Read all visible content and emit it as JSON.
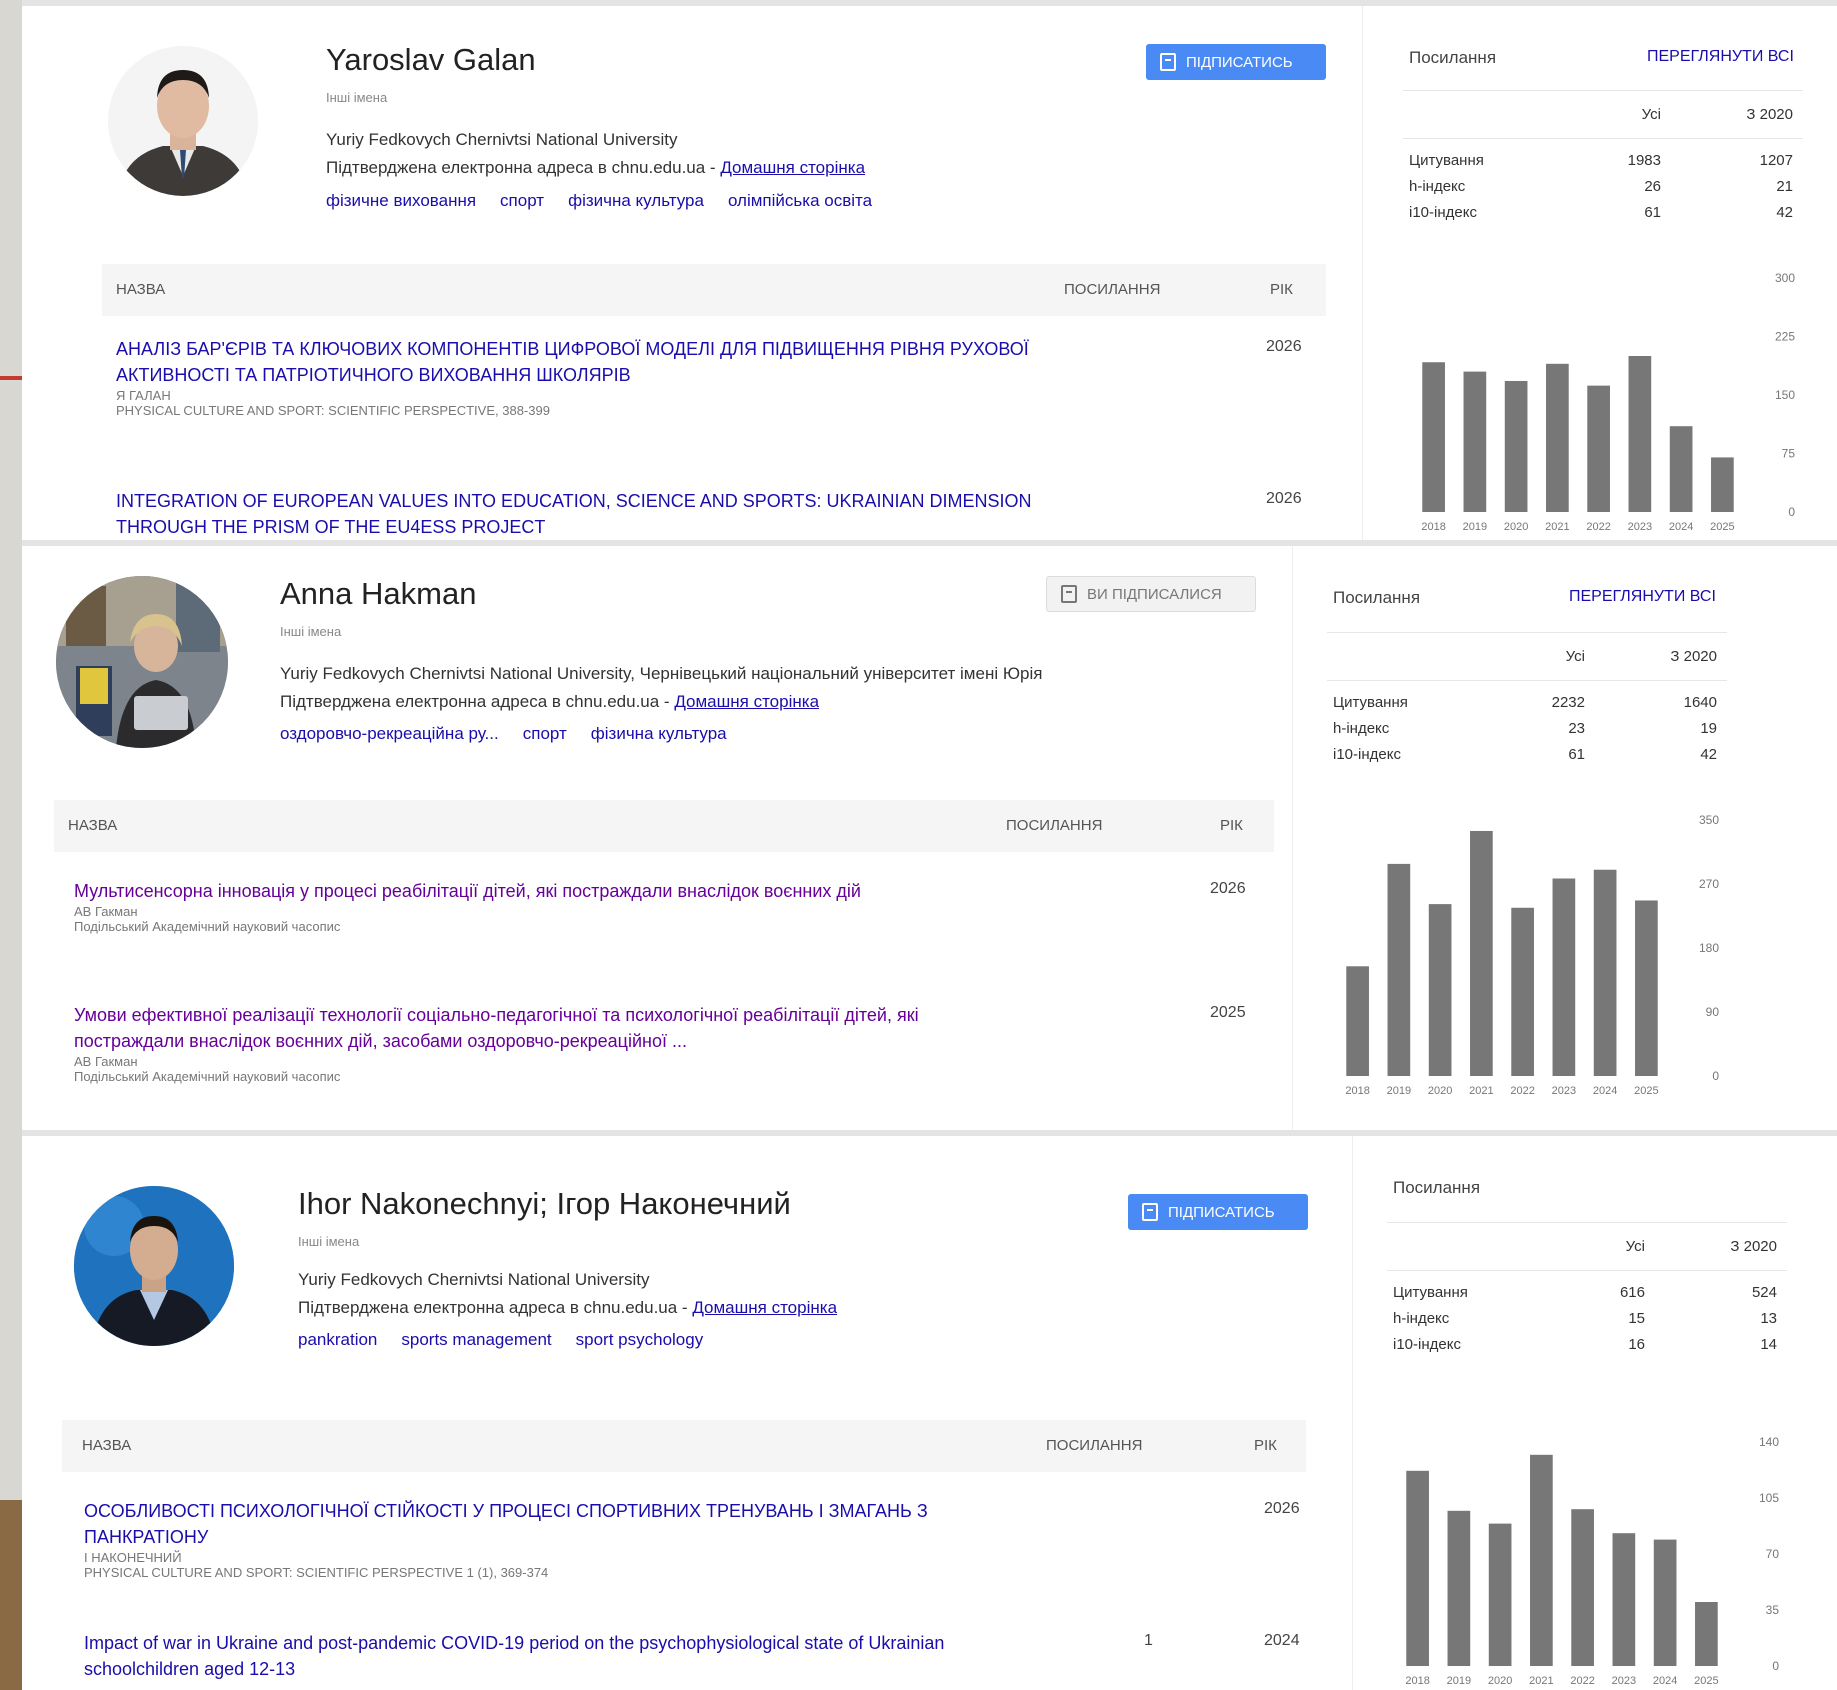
{
  "profiles": [
    {
      "name": "Yaroslav Galan",
      "edit_link": "Інші імена",
      "affiliation": "Yuriy Fedkovych Chernivtsi National University",
      "email_text": "Підтверджена електронна адреса в chnu.edu.ua - ",
      "homepage": "Домашня сторінка",
      "interests": [
        "фізичне виховання",
        "спорт",
        "фізична культура",
        "олімпійська освіта"
      ],
      "follow_label": "ПІДПИСАТИСЬ",
      "table_headers": {
        "title": "НАЗВА",
        "cited": "ПОСИЛАННЯ",
        "year": "РІК"
      },
      "publications": [
        {
          "title": "АНАЛІЗ БАР'ЄРІВ ТА КЛЮЧОВИХ КОМПОНЕНТІВ ЦИФРОВОЇ МОДЕЛІ ДЛЯ ПІДВИЩЕННЯ РІВНЯ РУХОВОЇ АКТИВНОСТІ ТА ПАТРІОТИЧНОГО ВИХОВАННЯ ШКОЛЯРІВ",
          "authors": "Я ГАЛАН",
          "venue": "PHYSICAL CULTURE AND SPORT: SCIENTIFIC PERSPECTIVE, 388-399",
          "cited": "",
          "year": "2026"
        },
        {
          "title": "INTEGRATION OF EUROPEAN VALUES INTO EDUCATION, SCIENCE AND SPORTS: UKRAINIAN DIMENSION THROUGH THE PRISM OF THE EU4ESS PROJECT",
          "authors": "",
          "venue": "",
          "cited": "",
          "year": "2026"
        }
      ],
      "sidebar": {
        "heading": "Посилання",
        "view_all": "ПЕРЕГЛЯНУТИ ВСІ",
        "col_all": "Усі",
        "col_since": "З 2020",
        "rows": [
          {
            "label": "Цитування",
            "all": "1983",
            "since": "1207"
          },
          {
            "label": "h-індекс",
            "all": "26",
            "since": "21"
          },
          {
            "label": "i10-індекс",
            "all": "61",
            "since": "42"
          }
        ]
      },
      "chart_data": {
        "type": "bar",
        "categories": [
          "2018",
          "2019",
          "2020",
          "2021",
          "2022",
          "2023",
          "2024",
          "2025"
        ],
        "values": [
          192,
          180,
          168,
          190,
          162,
          200,
          110,
          70
        ],
        "ylim": [
          0,
          300
        ],
        "yticks": [
          "0",
          "75",
          "150",
          "225",
          "300"
        ],
        "bar_color": "#777777"
      }
    },
    {
      "name": "Anna Hakman",
      "edit_link": "Інші імена",
      "affiliation": "Yuriy Fedkovych Chernivtsi National University, Чернівецький національний університет імені Юрія",
      "email_text": "Підтверджена електронна адреса в chnu.edu.ua - ",
      "homepage": "Домашня сторінка",
      "interests": [
        "оздоровчо-рекреаційна ру...",
        "спорт",
        "фізична культура"
      ],
      "follow_label": "ВИ ПІДПИСАЛИСЯ",
      "table_headers": {
        "title": "НАЗВА",
        "cited": "ПОСИЛАННЯ",
        "year": "РІК"
      },
      "publications": [
        {
          "title": "Мультисенсорна інновація у процесі реабілітації дітей, які постраждали внаслідок воєнних дій",
          "authors": "АВ Гакман",
          "venue": "Подільський Академічний науковий часопис",
          "cited": "",
          "year": "2026"
        },
        {
          "title": "Умови ефективної реалізації технології соціально-педагогічної та психологічної реабілітації дітей, які постраждали внаслідок воєнних дій, засобами оздоровчо-рекреаційної ...",
          "authors": "АВ Гакман",
          "venue": "Подільський Академічний науковий часопис",
          "cited": "",
          "year": "2025"
        }
      ],
      "sidebar": {
        "heading": "Посилання",
        "view_all": "ПЕРЕГЛЯНУТИ ВСІ",
        "col_all": "Усі",
        "col_since": "З 2020",
        "rows": [
          {
            "label": "Цитування",
            "all": "2232",
            "since": "1640"
          },
          {
            "label": "h-індекс",
            "all": "23",
            "since": "19"
          },
          {
            "label": "i10-індекс",
            "all": "61",
            "since": "42"
          }
        ]
      },
      "chart_data": {
        "type": "bar",
        "categories": [
          "2018",
          "2019",
          "2020",
          "2021",
          "2022",
          "2023",
          "2024",
          "2025"
        ],
        "values": [
          150,
          290,
          235,
          335,
          230,
          270,
          282,
          240
        ],
        "ylim": [
          0,
          350
        ],
        "yticks": [
          "0",
          "90",
          "180",
          "270",
          "350"
        ],
        "bar_color": "#777777"
      }
    },
    {
      "name": "Ihor Nakonechnyi; Ігор Наконечний",
      "edit_link": "Інші імена",
      "affiliation": "Yuriy Fedkovych Chernivtsi National University",
      "email_text": "Підтверджена електронна адреса в chnu.edu.ua - ",
      "homepage": "Домашня сторінка",
      "interests": [
        "pankration",
        "sports management",
        "sport psychology"
      ],
      "follow_label": "ПІДПИСАТИСЬ",
      "table_headers": {
        "title": "НАЗВА",
        "cited": "ПОСИЛАННЯ",
        "year": "РІК"
      },
      "publications": [
        {
          "title": "ОСОБЛИВОСТІ ПСИХОЛОГІЧНОЇ СТІЙКОСТІ У ПРОЦЕСІ СПОРТИВНИХ ТРЕНУВАНЬ І ЗМАГАНЬ З ПАНКРАТІОНУ",
          "authors": "І НАКОНЕЧНИЙ",
          "venue": "PHYSICAL CULTURE AND SPORT: SCIENTIFIC PERSPECTIVE 1 (1), 369-374",
          "cited": "",
          "year": "2026"
        },
        {
          "title": "Impact of war in Ukraine and post-pandemic COVID-19 period on the psychophysiological state of Ukrainian schoolchildren aged 12-13",
          "authors": "",
          "venue": "",
          "cited": "1",
          "year": "2024"
        }
      ],
      "sidebar": {
        "heading": "Посилання",
        "view_all": "",
        "col_all": "Усі",
        "col_since": "З 2020",
        "rows": [
          {
            "label": "Цитування",
            "all": "616",
            "since": "524"
          },
          {
            "label": "h-індекс",
            "all": "15",
            "since": "13"
          },
          {
            "label": "i10-індекс",
            "all": "16",
            "since": "14"
          }
        ]
      },
      "chart_data": {
        "type": "bar",
        "categories": [
          "2018",
          "2019",
          "2020",
          "2021",
          "2022",
          "2023",
          "2024",
          "2025"
        ],
        "values": [
          122,
          97,
          89,
          132,
          98,
          83,
          79,
          40
        ],
        "ylim": [
          0,
          140
        ],
        "yticks": [
          "0",
          "35",
          "70",
          "105",
          "140"
        ],
        "bar_color": "#777777"
      }
    }
  ]
}
